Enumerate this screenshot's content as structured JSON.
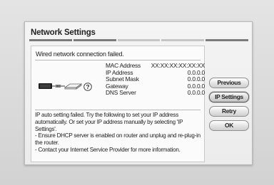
{
  "dialog": {
    "title": "Network Settings",
    "title_tabs": 5
  },
  "status": {
    "text": "Wired network connection failed."
  },
  "diagram": {
    "icons": [
      "tv-icon",
      "cable-icon",
      "router-icon",
      "question-mark-icon"
    ]
  },
  "info": {
    "rows": [
      {
        "label": "MAC Address",
        "value": "XX:XX:XX:XX:XX:XX"
      },
      {
        "label": "IP Address",
        "value": "0.0.0.0"
      },
      {
        "label": "Subnet Mask",
        "value": "0.0.0.0"
      },
      {
        "label": "Gateway",
        "value": "0.0.0.0"
      },
      {
        "label": "DNS Server",
        "value": "0.0.0.0"
      }
    ]
  },
  "message": {
    "lines": [
      "IP auto setting failed. Try the following to set your IP address automatically. Or set your IP address manually by selecting 'IP Settings'.",
      "- Ensure DHCP server is enabled on router and unplug and re-plug-in the router.",
      "- Contact your Internet Service Provider for more information."
    ]
  },
  "buttons": {
    "previous": "Previous",
    "ip_settings": "IP Settings",
    "retry": "Retry",
    "ok": "OK"
  },
  "colors": {
    "panel_bg": "#fbfbfb",
    "dialog_bg": "#f0f0f0",
    "text": "#222222",
    "active_tab": "#7b7b7b"
  }
}
